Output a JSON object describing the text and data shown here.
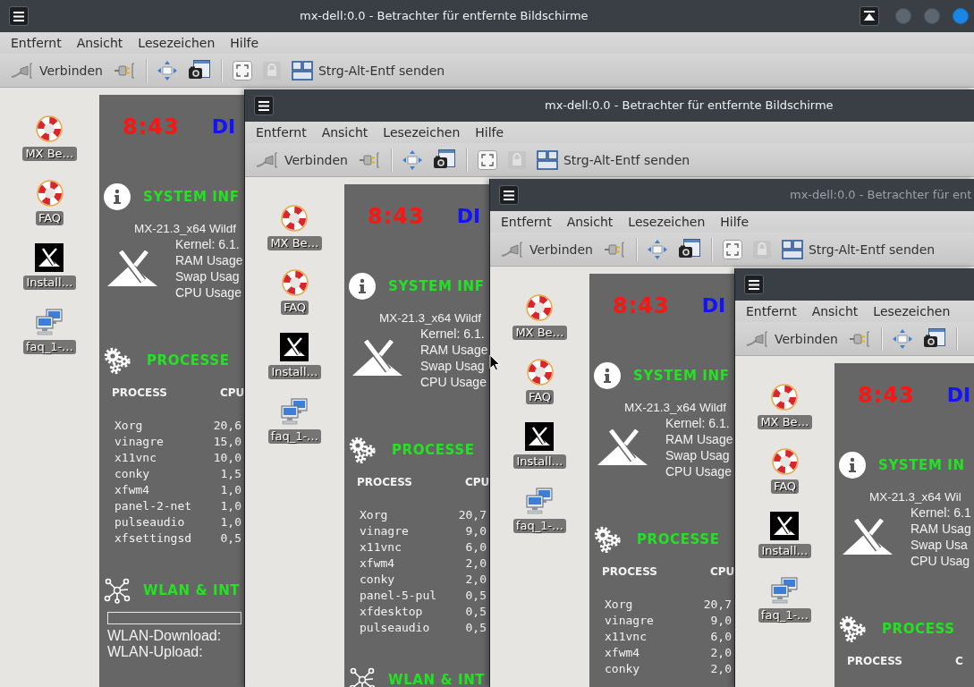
{
  "windows": [
    {
      "title": "mx-dell:0.0 - Betrachter für entfernte Bildschirme",
      "active": true,
      "window_buttons": [
        {
          "kind": "keep_above"
        },
        {
          "kind": "minimize"
        },
        {
          "kind": "maximize"
        },
        {
          "kind": "close"
        }
      ],
      "menu": [
        "Entfernt",
        "Ansicht",
        "Lesezeichen",
        "Hilfe"
      ],
      "toolbar": [
        {
          "kind": "connect",
          "label": "Verbinden",
          "disabled": false
        },
        {
          "kind": "disconnect",
          "disabled": false
        },
        {
          "kind": "separator"
        },
        {
          "kind": "fit",
          "disabled": false
        },
        {
          "kind": "screenshot",
          "disabled": false
        },
        {
          "kind": "separator"
        },
        {
          "kind": "fullscreen",
          "disabled": false
        },
        {
          "kind": "lock",
          "disabled": true
        },
        {
          "kind": "send_keys",
          "label": "Strg-Alt-Entf senden",
          "disabled": false
        }
      ],
      "desktop_icons": [
        {
          "kind": "lifebuoy",
          "label": "MX Be…"
        },
        {
          "kind": "lifebuoy",
          "label": "FAQ"
        },
        {
          "kind": "installer",
          "label": "Install…"
        },
        {
          "kind": "network",
          "label": "faq_1-…"
        }
      ],
      "conky": {
        "time": "8:43",
        "day": "DI",
        "system_heading": "SYSTEM INF",
        "os": "MX-21.3_x64 Wildf",
        "stats": [
          "Kernel: 6.1.",
          "RAM Usage",
          "Swap Usag",
          "CPU Usage"
        ],
        "processes_heading": "PROCESSE",
        "process_columns": [
          "PROCESS",
          "CPU"
        ],
        "processes": [
          {
            "name": "Xorg",
            "cpu": "20,6"
          },
          {
            "name": "vinagre",
            "cpu": "15,0"
          },
          {
            "name": "x11vnc",
            "cpu": "10,0"
          },
          {
            "name": "conky",
            "cpu": "1,5"
          },
          {
            "name": "xfwm4",
            "cpu": "1,0"
          },
          {
            "name": "panel-2-net",
            "cpu": "1,0"
          },
          {
            "name": "pulseaudio",
            "cpu": "1,0"
          },
          {
            "name": "xfsettingsd",
            "cpu": "0,5"
          }
        ],
        "network_heading": "WLAN & INT",
        "network_lines": [
          "WLAN-Download:",
          "WLAN-Upload:"
        ]
      }
    },
    {
      "title": "mx-dell:0.0 - Betrachter für entfernte Bildschirme",
      "active": true,
      "menu": [
        "Entfernt",
        "Ansicht",
        "Lesezeichen",
        "Hilfe"
      ],
      "toolbar": [
        {
          "kind": "connect",
          "label": "Verbinden",
          "disabled": false
        },
        {
          "kind": "disconnect",
          "disabled": false
        },
        {
          "kind": "separator"
        },
        {
          "kind": "fit",
          "disabled": false
        },
        {
          "kind": "screenshot",
          "disabled": false
        },
        {
          "kind": "separator"
        },
        {
          "kind": "fullscreen",
          "disabled": false
        },
        {
          "kind": "lock",
          "disabled": true
        },
        {
          "kind": "send_keys",
          "label": "Strg-Alt-Entf senden",
          "disabled": false
        }
      ],
      "desktop_icons": [
        {
          "kind": "lifebuoy",
          "label": "MX Be…"
        },
        {
          "kind": "lifebuoy",
          "label": "FAQ"
        },
        {
          "kind": "installer",
          "label": "Install…"
        },
        {
          "kind": "network",
          "label": "faq_1-…"
        }
      ],
      "conky": {
        "time": "8:43",
        "day": "DI",
        "system_heading": "SYSTEM INF",
        "os": "MX-21.3_x64 Wildf",
        "stats": [
          "Kernel: 6.1.",
          "RAM Usage",
          "Swap Usag",
          "CPU Usage"
        ],
        "processes_heading": "PROCESSE",
        "process_columns": [
          "PROCESS",
          "CPU"
        ],
        "processes": [
          {
            "name": "Xorg",
            "cpu": "20,7"
          },
          {
            "name": "vinagre",
            "cpu": "9,0"
          },
          {
            "name": "x11vnc",
            "cpu": "6,0"
          },
          {
            "name": "xfwm4",
            "cpu": "2,0"
          },
          {
            "name": "conky",
            "cpu": "2,0"
          },
          {
            "name": "panel-5-pul",
            "cpu": "0,5"
          },
          {
            "name": "xfdesktop",
            "cpu": "0,5"
          },
          {
            "name": "pulseaudio",
            "cpu": "0,5"
          }
        ],
        "network_heading": "WLAN & INT"
      }
    },
    {
      "title": "mx-dell:0.0 - Betrachter für ent",
      "active": false,
      "menu": [
        "Entfernt",
        "Ansicht",
        "Lesezeichen",
        "Hilfe"
      ],
      "toolbar": [
        {
          "kind": "connect",
          "label": "Verbinden",
          "disabled": false
        },
        {
          "kind": "disconnect",
          "disabled": false
        },
        {
          "kind": "separator"
        },
        {
          "kind": "fit",
          "disabled": false
        },
        {
          "kind": "screenshot",
          "disabled": false
        },
        {
          "kind": "separator"
        },
        {
          "kind": "fullscreen",
          "disabled": false
        },
        {
          "kind": "lock",
          "disabled": true
        },
        {
          "kind": "send_keys",
          "label": "Strg-Alt-Entf senden",
          "disabled": false
        }
      ],
      "desktop_icons": [
        {
          "kind": "lifebuoy",
          "label": "MX Be…"
        },
        {
          "kind": "lifebuoy",
          "label": "FAQ"
        },
        {
          "kind": "installer",
          "label": "Install…"
        },
        {
          "kind": "network",
          "label": "faq_1-…"
        }
      ],
      "conky": {
        "time": "8:43",
        "day": "DI",
        "system_heading": "SYSTEM INF",
        "os": "MX-21.3_x64 Wildf",
        "stats": [
          "Kernel: 6.1.",
          "RAM Usage",
          "Swap Usag",
          "CPU Usage"
        ],
        "processes_heading": "PROCESSE",
        "process_columns": [
          "PROCESS",
          "CPU"
        ],
        "processes": [
          {
            "name": "Xorg",
            "cpu": "20,7"
          },
          {
            "name": "vinagre",
            "cpu": "9,0"
          },
          {
            "name": "x11vnc",
            "cpu": "6,0"
          },
          {
            "name": "xfwm4",
            "cpu": "2,0"
          },
          {
            "name": "conky",
            "cpu": "2,0"
          }
        ]
      }
    },
    {
      "menu": [
        "Entfernt",
        "Ansicht",
        "Lesezeichen"
      ],
      "toolbar": [
        {
          "kind": "connect",
          "label": "Verbinden",
          "disabled": false
        },
        {
          "kind": "disconnect",
          "disabled": false
        },
        {
          "kind": "separator"
        },
        {
          "kind": "fit",
          "disabled": false
        },
        {
          "kind": "screenshot",
          "disabled": false
        },
        {
          "kind": "separator"
        }
      ],
      "desktop_icons": [
        {
          "kind": "lifebuoy",
          "label": "MX Be…"
        },
        {
          "kind": "lifebuoy",
          "label": "FAQ"
        },
        {
          "kind": "installer",
          "label": "Install…"
        },
        {
          "kind": "network",
          "label": "faq_1-…"
        }
      ],
      "conky": {
        "time": "8:43",
        "day": "DI",
        "system_heading": "SYSTEM IN",
        "os": "MX-21.3_x64 Wil",
        "stats": [
          "Kernel: 6.1",
          "RAM Usag",
          "Swap Usa",
          "CPU Usag"
        ],
        "processes_heading": "PROCESS",
        "process_columns": [
          "PROCESS",
          "C"
        ]
      }
    }
  ]
}
